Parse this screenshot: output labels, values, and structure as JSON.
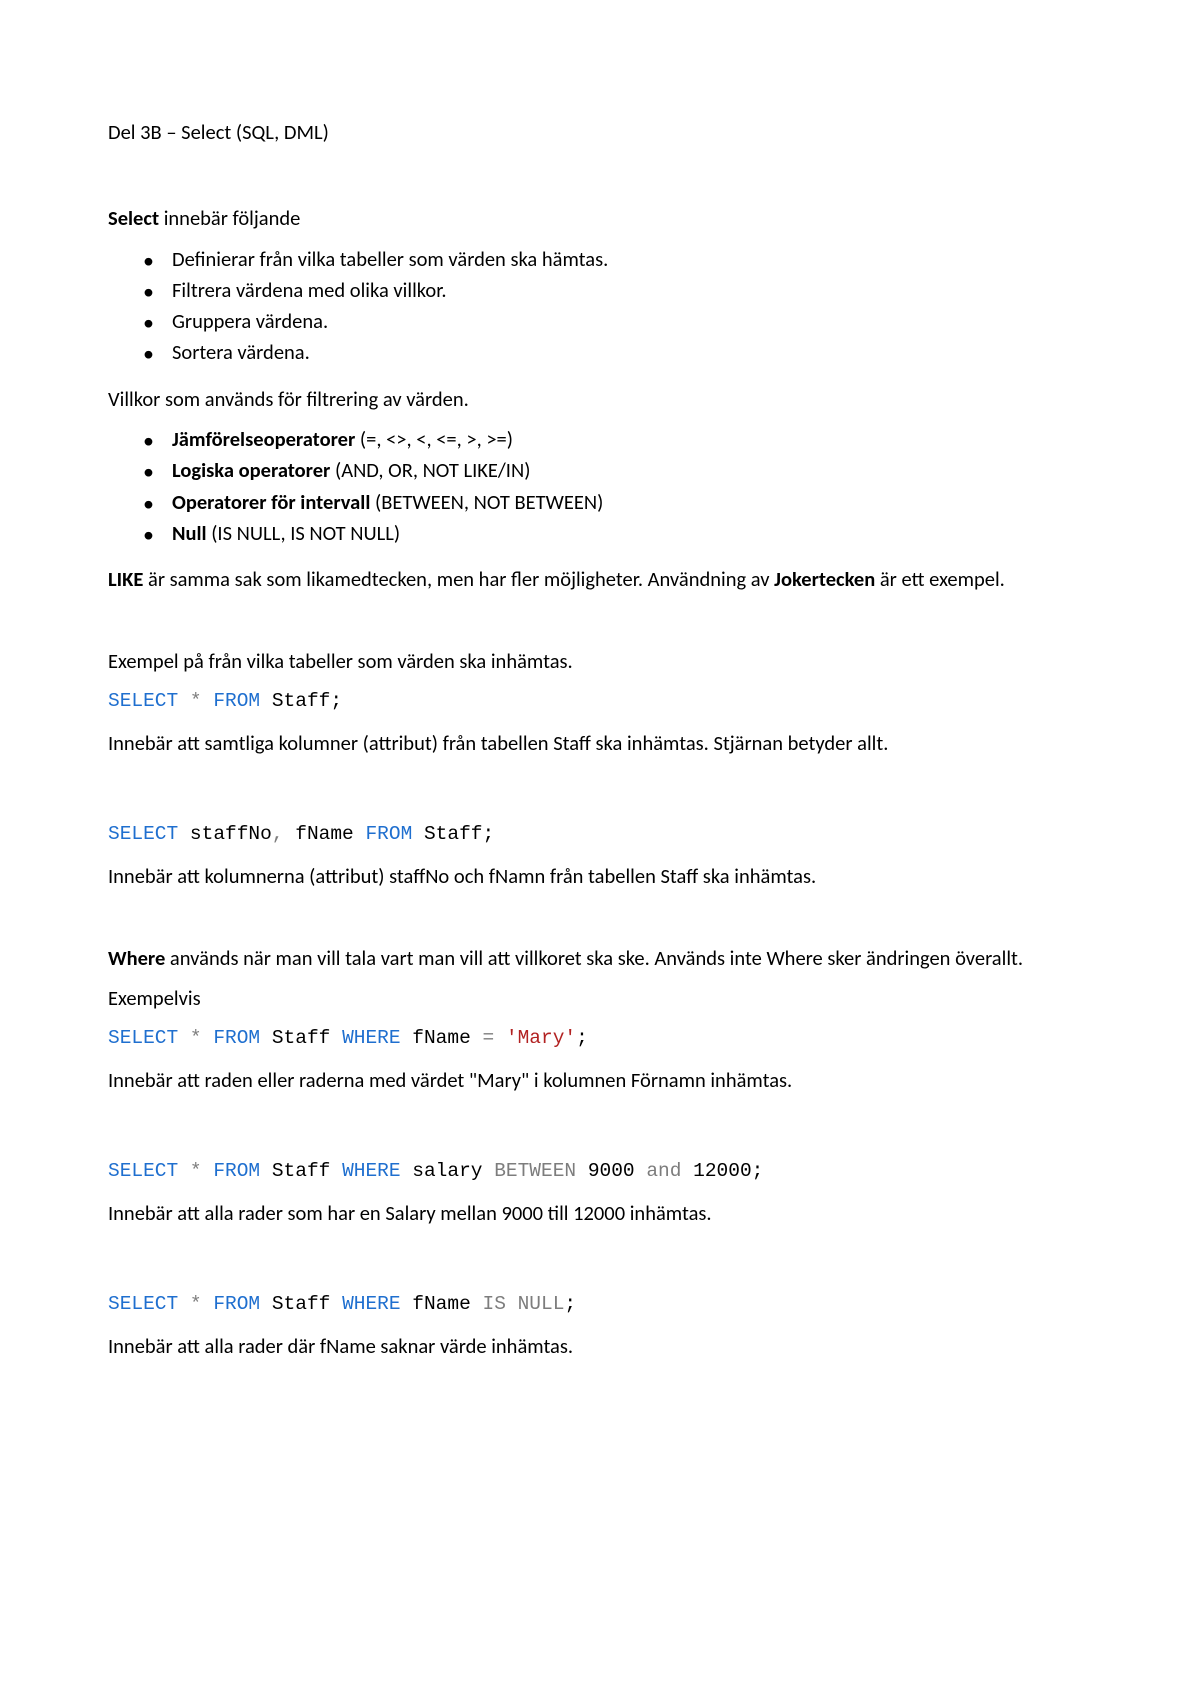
{
  "title": "Del 3B – Select (SQL, DML)",
  "intro": {
    "strong": "Select",
    "rest": " innebär följande"
  },
  "list1": [
    "Definierar från vilka tabeller som värden ska hämtas.",
    "Filtrera värdena med olika villkor.",
    "Gruppera värdena.",
    "Sortera värdena."
  ],
  "para1": "Villkor som används för filtrering av värden.",
  "list2": [
    {
      "label": "Jämförelseoperatorer",
      "rest": " (=, <>, <, <=, >, >=)"
    },
    {
      "label": "Logiska operatorer",
      "rest": " (AND, OR, NOT LIKE/IN)"
    },
    {
      "label": "Operatorer för intervall",
      "rest": " (BETWEEN, NOT BETWEEN)"
    },
    {
      "label": "Null",
      "rest": " (IS NULL, IS NOT NULL)"
    }
  ],
  "like_para": {
    "a": "LIKE",
    "b": " är samma sak som likamedtecken, men har fler möjligheter. Användning av ",
    "c": "Jokertecken",
    "d": " är ett exempel."
  },
  "ex_intro": "Exempel på från vilka tabeller som värden ska inhämtas.",
  "code1": {
    "select": "SELECT",
    "star": " * ",
    "from": "FROM",
    "rest": " Staff;"
  },
  "code1_desc": "Innebär att samtliga kolumner (attribut) från tabellen Staff ska inhämtas. Stjärnan betyder allt.",
  "code2": {
    "select": "SELECT",
    "cols": " staffNo",
    "comma": ",",
    "cols2": " fName ",
    "from": "FROM",
    "rest": " Staff;"
  },
  "code2_desc": "Innebär att kolumnerna (attribut) staffNo och fNamn från tabellen Staff ska inhämtas.",
  "where_para": {
    "a": "Where",
    "b": " används när man vill tala vart man vill att villkoret ska ske. Används inte Where sker ändringen överallt."
  },
  "exempelvis": "Exempelvis",
  "code3": {
    "select": "SELECT",
    "star": " * ",
    "from": "FROM",
    "tbl": " Staff ",
    "where": "WHERE",
    "col": " fName ",
    "eq": "=",
    "sp": " ",
    "val": "'Mary'",
    "end": ";"
  },
  "code3_desc": "Innebär att raden eller raderna med värdet \"Mary\" i kolumnen Förnamn inhämtas.",
  "code4": {
    "select": "SELECT",
    "star": " * ",
    "from": "FROM",
    "tbl": " Staff ",
    "where": "WHERE",
    "col": " salary ",
    "between": "BETWEEN",
    "v1": " 9000 ",
    "and": "and",
    "v2": " 12000",
    "end": ";"
  },
  "code4_desc": "Innebär att alla rader som har en Salary mellan 9000 till 12000 inhämtas.",
  "code5": {
    "select": "SELECT",
    "star": " * ",
    "from": "FROM",
    "tbl": " Staff ",
    "where": "WHERE",
    "col": " fName ",
    "isnull": "IS NULL",
    "end": ";"
  },
  "code5_desc": "Innebär att alla rader där fName saknar värde inhämtas."
}
